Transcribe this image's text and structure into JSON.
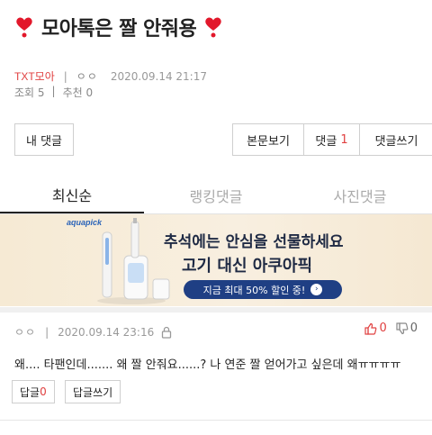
{
  "post": {
    "title": "모아톡은 짤 안줘용",
    "author": "TXT모아",
    "nickname": "ㅇㅇ",
    "datetime": "2020.09.14 21:17",
    "views": "조회 5",
    "recommend": "추천 0"
  },
  "actions": {
    "my_comments": "내 댓글",
    "view_post": "본문보기",
    "comments_label": "댓글",
    "comments_count": "1",
    "write_comment": "댓글쓰기"
  },
  "tabs": [
    {
      "label": "최신순",
      "active": true
    },
    {
      "label": "랭킹댓글",
      "active": false
    },
    {
      "label": "사진댓글",
      "active": false
    }
  ],
  "ad": {
    "brand": "aquapick",
    "line1": "추석에는 안심을 선물하세요",
    "line2": "고기 대신 아쿠아픽",
    "pill": "지금 최대 50% 할인 중!",
    "arrow": "›"
  },
  "comment": {
    "nickname": "ㅇㅇ",
    "datetime": "2020.09.14 23:16",
    "up_count": "0",
    "down_count": "0",
    "body": "왜.... 타팬인데....... 왜 짤 안줘요......? 나 연준 짤 얻어가고 싶은데 왜ㅠㅠㅠㅠ",
    "reply_label": "답글",
    "reply_count": "0",
    "write_reply": "답글쓰기"
  },
  "colors": {
    "accent": "#e04040",
    "ad_pill": "#1f3f84",
    "heart": "#e2182b"
  }
}
